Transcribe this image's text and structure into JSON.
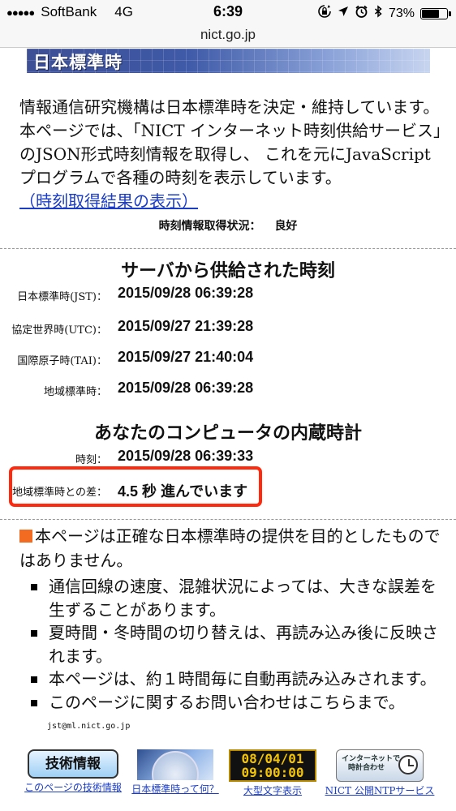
{
  "status_bar": {
    "dots": "●●●●●",
    "carrier": "SoftBank",
    "network": "4G",
    "time": "6:39",
    "battery_percent": "73%",
    "battery_level": 0.73,
    "icons": [
      "rotation-lock-icon",
      "location-arrow-icon",
      "alarm-icon",
      "bluetooth-icon",
      "battery-icon"
    ]
  },
  "browser": {
    "url": "nict.go.jp"
  },
  "banner": {
    "title": "日本標準時",
    "color_start": "#3d4f95",
    "color_end": "#c8d5f0"
  },
  "intro": {
    "text": "情報通信研究機構は日本標準時を決定・維持しています。本ページでは、「NICT インターネット時刻供給サービス」のJSON形式時刻情報を取得し、 これを元にJavaScript プログラムで各種の時刻を表示しています。",
    "link": "（時刻取得結果の表示）"
  },
  "fetch_status": {
    "label": "時刻情報取得状況：",
    "value": "良好"
  },
  "server_time": {
    "title": "サーバから供給された時刻",
    "rows": [
      {
        "label": "日本標準時(JST)：",
        "value": "2015/09/28 06:39:28"
      },
      {
        "label": "協定世界時(UTC)：",
        "value": "2015/09/27 21:39:28"
      },
      {
        "label": "国際原子時(TAI)：",
        "value": "2015/09/27 21:40:04"
      },
      {
        "label": "地域標準時：",
        "value": "2015/09/28 06:39:28"
      }
    ]
  },
  "local_clock": {
    "title": "あなたのコンピュータの内蔵時計",
    "time_label": "時刻：",
    "time_value": "2015/09/28 06:39:33",
    "diff_label": "地域標準時との差：",
    "diff_value": "4.5 秒 進んでいます",
    "highlight_color": "#ff2a0e"
  },
  "notice": {
    "text": "本ページは正確な日本標準時の提供を目的としたものではありません。",
    "accent_color": "#f26b21",
    "bullets": [
      "通信回線の速度、混雑状況によっては、大きな誤差を生ずることがあります。",
      "夏時間・冬時間の切り替えは、再読み込み後に反映されます。",
      "本ページは、約１時間毎に自動再読み込みされます。",
      "このページに関するお問い合わせはこちらまで。"
    ]
  },
  "contact_email": "jst@ml.nict.go.jp",
  "footer": {
    "tech_button": "技術情報",
    "tech_caption": "このページの技術情報",
    "jst_caption": "日本標準時って何？",
    "big_clock_line1": "08/04/01",
    "big_clock_line2": "09:00:00",
    "big_caption": "大型文字表示",
    "ntp_line1": "インターネットで",
    "ntp_line2": "時計合わせ",
    "ntp_caption": "NICT 公開NTPサービス"
  }
}
